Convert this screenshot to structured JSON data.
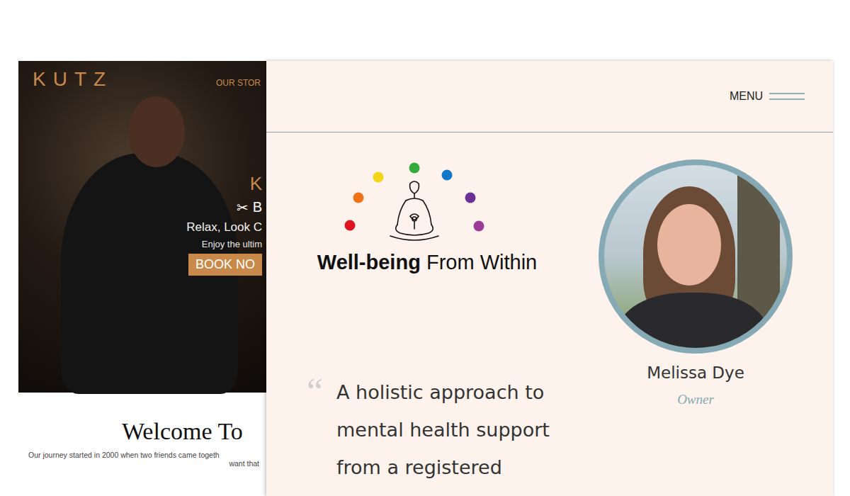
{
  "left_site": {
    "logo": "KUTZ",
    "nav": [
      "OUR STOR"
    ],
    "hero": {
      "heading": "K",
      "tagline_icon": "✂",
      "tagline": "B",
      "subtitle": "Relax, Look C",
      "text": "Enjoy the ultim",
      "button": "BOOK NO"
    },
    "welcome": {
      "title": "Welcome To",
      "body": [
        "Our journey started in 2000 when two friends came togeth",
        "want that"
      ]
    }
  },
  "right_site": {
    "menu": {
      "label": "MENU"
    },
    "brand": {
      "bold": "Well-being",
      "rest": "From Within"
    },
    "quote": {
      "mark": "“",
      "lines": [
        "A holistic approach to",
        "mental health support",
        "from a registered"
      ]
    },
    "profile": {
      "name": "Melissa Dye",
      "role": "Owner"
    }
  }
}
